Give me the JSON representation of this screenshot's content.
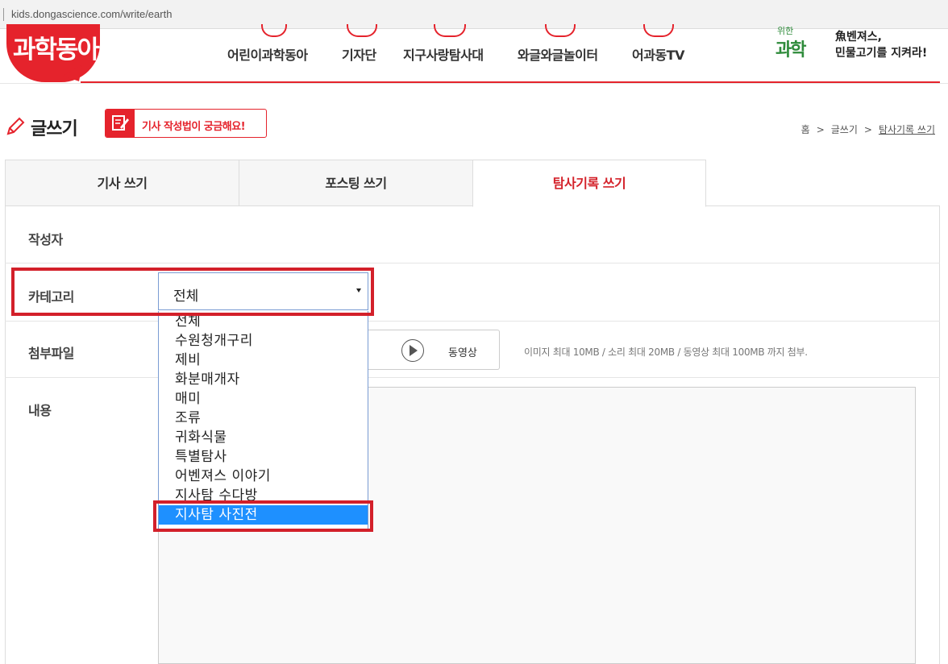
{
  "browser": {
    "url": "kids.dongascience.com/write/earth"
  },
  "header": {
    "logo": "과학동아",
    "nav": [
      "어린이과학동아",
      "기자단",
      "지구사랑탐사대",
      "와글와글놀이터",
      "어과동TV"
    ],
    "promo": {
      "badge_small": "위한",
      "badge_big": "과학",
      "line1": "魚벤져스,",
      "line2": "민물고기를 지켜라!"
    }
  },
  "page": {
    "title": "글쓰기",
    "howto_label": "기사 작성법이 궁금해요!",
    "breadcrumb": [
      "홈",
      "글쓰기",
      "탐사기록 쓰기"
    ]
  },
  "tabs": [
    {
      "label": "기사 쓰기",
      "active": false
    },
    {
      "label": "포스팅 쓰기",
      "active": false
    },
    {
      "label": "탐사기록 쓰기",
      "active": true
    }
  ],
  "form": {
    "author_label": "작성자",
    "category_label": "카테고리",
    "category_value": "전체",
    "attachment_label": "첨부파일",
    "video_label": "동영상",
    "upload_note": "이미지 최대 10MB / 소리 최대 20MB / 동영상 최대 100MB 까지 첨부.",
    "content_label": "내용"
  },
  "dropdown": {
    "options": [
      "전체",
      "수원청개구리",
      "제비",
      "화분매개자",
      "매미",
      "조류",
      "귀화식물",
      "특별탐사",
      "어벤져스 이야기",
      "지사탐 수다방",
      "지사탐 사진전"
    ],
    "highlighted": "지사탐 사진전"
  },
  "colors": {
    "brand_red": "#e5232c",
    "highlight_blue": "#1e90ff",
    "annotation_red": "#d3202a"
  }
}
